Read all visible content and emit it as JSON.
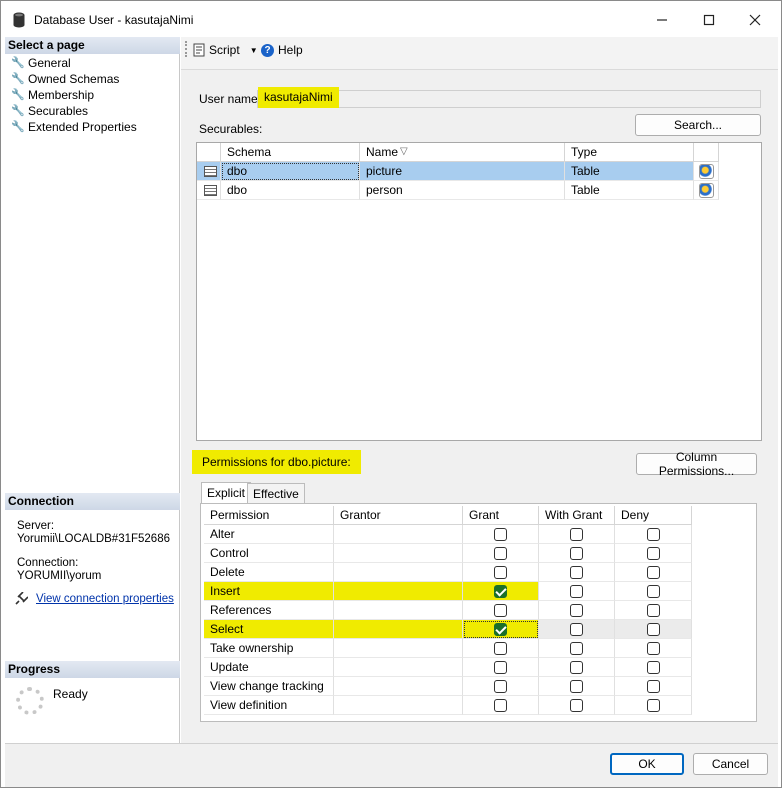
{
  "window": {
    "title": "Database User - kasutajaNimi"
  },
  "left": {
    "select_page_header": "Select a page",
    "pages": [
      "General",
      "Owned Schemas",
      "Membership",
      "Securables",
      "Extended Properties"
    ],
    "connection_header": "Connection",
    "server_label": "Server:",
    "server_value": "Yorumii\\LOCALDB#31F52686",
    "connection_label": "Connection:",
    "connection_value": "YORUMII\\yorum",
    "view_connection_link": "View connection properties",
    "progress_header": "Progress",
    "progress_status": "Ready"
  },
  "toolbar": {
    "script_label": "Script",
    "help_label": "Help"
  },
  "main": {
    "username_label": "User name:",
    "username_value": "kasutajaNimi",
    "securables_label": "Securables:",
    "search_button": "Search...",
    "securables_columns": [
      "Schema",
      "Name",
      "Type"
    ],
    "securables_rows": [
      {
        "schema": "dbo",
        "name": "picture",
        "type": "Table"
      },
      {
        "schema": "dbo",
        "name": "person",
        "type": "Table"
      }
    ],
    "permissions_label": "Permissions for dbo.picture:",
    "column_permissions_button": "Column Permissions...",
    "tabs": [
      "Explicit",
      "Effective"
    ],
    "perm_columns": [
      "Permission",
      "Grantor",
      "Grant",
      "With Grant",
      "Deny"
    ],
    "permissions": [
      {
        "name": "Alter",
        "grant": false,
        "with_grant": false,
        "deny": false
      },
      {
        "name": "Control",
        "grant": false,
        "with_grant": false,
        "deny": false
      },
      {
        "name": "Delete",
        "grant": false,
        "with_grant": false,
        "deny": false
      },
      {
        "name": "Insert",
        "grant": true,
        "with_grant": false,
        "deny": false
      },
      {
        "name": "References",
        "grant": false,
        "with_grant": false,
        "deny": false
      },
      {
        "name": "Select",
        "grant": true,
        "with_grant": false,
        "deny": false
      },
      {
        "name": "Take ownership",
        "grant": false,
        "with_grant": false,
        "deny": false
      },
      {
        "name": "Update",
        "grant": false,
        "with_grant": false,
        "deny": false
      },
      {
        "name": "View change tracking",
        "grant": false,
        "with_grant": false,
        "deny": false
      },
      {
        "name": "View definition",
        "grant": false,
        "with_grant": false,
        "deny": false
      }
    ]
  },
  "buttons": {
    "ok": "OK",
    "cancel": "Cancel"
  },
  "colors": {
    "highlight": "#f0eb00",
    "selection": "#a8cdef",
    "checked": "#1b6f2a"
  }
}
